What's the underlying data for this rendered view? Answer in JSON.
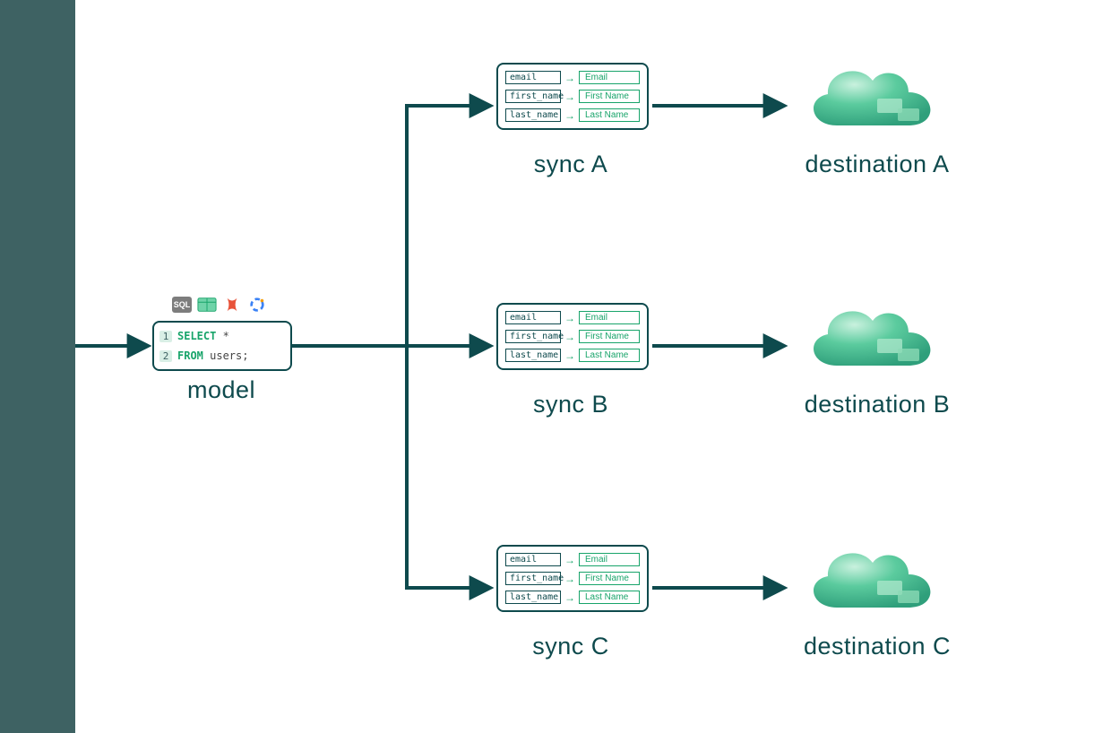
{
  "model": {
    "label": "model",
    "icons": {
      "sql_badge": "SQL"
    },
    "code": {
      "line1_num": "1",
      "line1_kw": "SELECT",
      "line1_rest": " *",
      "line2_num": "2",
      "line2_kw": "FROM",
      "line2_rest": " users;"
    }
  },
  "syncs": [
    {
      "label": "sync A",
      "mappings": [
        {
          "src": "email",
          "dst": "Email"
        },
        {
          "src": "first_name",
          "dst": "First Name"
        },
        {
          "src": "last_name",
          "dst": "Last Name"
        }
      ]
    },
    {
      "label": "sync B",
      "mappings": [
        {
          "src": "email",
          "dst": "Email"
        },
        {
          "src": "first_name",
          "dst": "First Name"
        },
        {
          "src": "last_name",
          "dst": "Last Name"
        }
      ]
    },
    {
      "label": "sync C",
      "mappings": [
        {
          "src": "email",
          "dst": "Email"
        },
        {
          "src": "first_name",
          "dst": "First Name"
        },
        {
          "src": "last_name",
          "dst": "Last Name"
        }
      ]
    }
  ],
  "destinations": [
    {
      "label": "destination A"
    },
    {
      "label": "destination B"
    },
    {
      "label": "destination C"
    }
  ],
  "colors": {
    "stroke": "#0e4a4d",
    "accent": "#18a46a",
    "cloud_light": "#bcebd5",
    "cloud_mid": "#56c79a",
    "cloud_dark": "#2f9f7b"
  }
}
